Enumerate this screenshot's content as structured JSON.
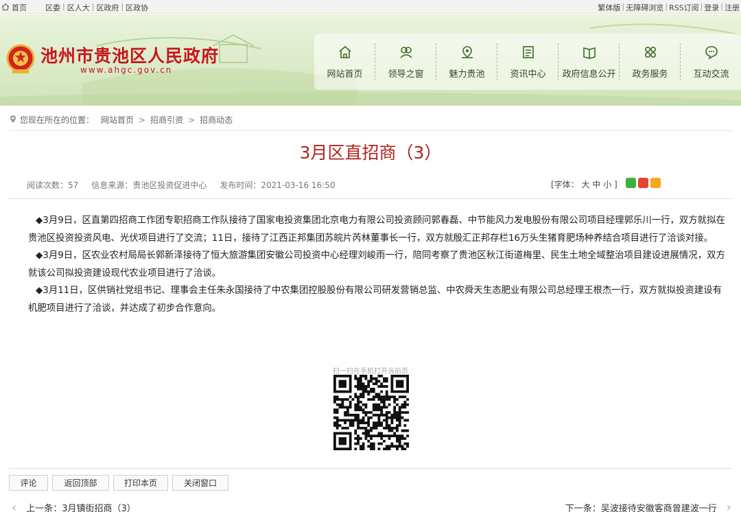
{
  "topbar": {
    "home": "首页",
    "left_links": [
      "区委",
      "区人大",
      "区政府",
      "区政协"
    ],
    "right_links": [
      "繁体版",
      "无障碍浏览",
      "RSS订阅",
      "登录",
      "注册"
    ]
  },
  "header": {
    "site_title": "池州市贵池区人民政府",
    "site_url": "www.ahgc.gov.cn",
    "nav": [
      {
        "label": "网站首页",
        "icon": "home-icon"
      },
      {
        "label": "领导之窗",
        "icon": "leaders-icon"
      },
      {
        "label": "魅力贵池",
        "icon": "location-icon"
      },
      {
        "label": "资讯中心",
        "icon": "news-icon"
      },
      {
        "label": "政府信息公开",
        "icon": "book-icon"
      },
      {
        "label": "政务服务",
        "icon": "grid-icon"
      },
      {
        "label": "互动交流",
        "icon": "chat-icon"
      }
    ]
  },
  "breadcrumb": {
    "prefix": "您现在所在的位置：",
    "items": [
      "网站首页",
      "招商引资",
      "招商动态"
    ]
  },
  "article": {
    "title": "3月区直招商（3）",
    "reads_label": "阅读次数：",
    "reads": "57",
    "source_label": "信息来源：",
    "source": "贵池区投资促进中心",
    "date_label": "发布时间：",
    "date": "2021-03-16 16:50",
    "font_label": "[字体：",
    "font_sizes": [
      "大",
      "中",
      "小"
    ],
    "font_close": "]",
    "paragraphs": [
      "◆3月9日，区直第四招商工作团专职招商工作队接待了国家电投资集团北京电力有限公司投资顾问郭春磊、中节能风力发电股份有限公司项目经理郭乐川一行，双方就拟在贵池区投资投资风电、光伏项目进行了交流；11日，接待了江西正邦集团苏皖片芮林董事长一行，双方就殷汇正邦存栏16万头生猪育肥场种养结合项目进行了洽谈对接。",
      "◆3月9日，区农业农村局局长郭新泽接待了恒大旅游集团安徽公司投资中心经理刘峻雨一行，陪同考察了贵池区秋江街道梅里、民生土地全域整治项目建设进展情况，双方就该公司拟投资建设现代农业项目进行了洽谈。",
      "◆3月11日，区供销社党组书记、理事会主任朱永国接待了中农集团控股股份有限公司研发营销总监、中农舜天生态肥业有限公司总经理王根杰一行，双方就拟投资建设有机肥项目进行了洽谈，并达成了初步合作意向。"
    ]
  },
  "qr": {
    "label": "扫一扫在手机打开当前页"
  },
  "actions": [
    "评论",
    "返回顶部",
    "打印本页",
    "关闭窗口"
  ],
  "pager": {
    "prev": "上一条：3月镇街招商（3）",
    "next": "下一条：吴波接待安徽客商曾建波一行"
  },
  "colors": {
    "brand_red": "#c8161d",
    "title_red": "#b0231e",
    "nav_green": "#2f4a21"
  }
}
